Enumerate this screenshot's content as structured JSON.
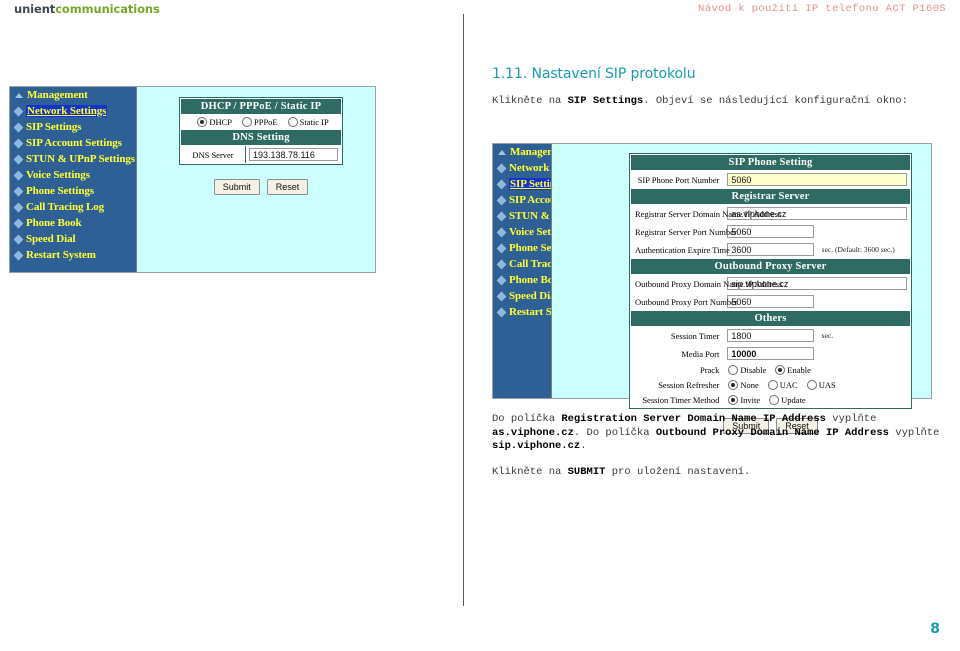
{
  "header": {
    "logo_part1": "unient",
    "logo_part2": "communications",
    "doc_title": "Návod k použití IP telefonu ACT P160S",
    "colors": {
      "logo_dark": "#3d4a52",
      "logo_green": "#7ba428",
      "title_red": "#e8908f"
    }
  },
  "document": {
    "section_title": "1.11. Nastavení SIP protokolu",
    "title_color": "#189ab4",
    "intro_before": "Klikněte na ",
    "intro_bold": "SIP Settings",
    "intro_after": ". Objeví se následující konfigurační okno:",
    "note_1": "Do políčka ",
    "note_1_bold": "Registration Server Domain Name IP Address",
    "note_2": " vyplňte ",
    "note_2_bold": "as.viphone.cz",
    "note_3": ". Do políčka ",
    "note_3_bold": "Outbound Proxy Domain Name IP Address",
    "note_4": " vyplňte ",
    "note_4_bold": "sip.viphone.cz",
    "note_5": ".",
    "final_before": "Klikněte na ",
    "final_bold": "SUBMIT",
    "final_after": " pro uložení nastavení.",
    "page_number": "8"
  },
  "menu": {
    "items": [
      {
        "label": "Management",
        "icon": "triangle-up-icon",
        "selected": false
      },
      {
        "label": "Network Settings",
        "icon": "diamond-icon",
        "selected": false
      },
      {
        "label": "SIP Settings",
        "icon": "diamond-icon",
        "selected": false
      },
      {
        "label": "SIP Account Settings",
        "icon": "diamond-icon",
        "selected": false
      },
      {
        "label": "STUN & UPnP Settings",
        "icon": "diamond-icon",
        "selected": false
      },
      {
        "label": "Voice Settings",
        "icon": "diamond-icon",
        "selected": false
      },
      {
        "label": "Phone Settings",
        "icon": "diamond-icon",
        "selected": false
      },
      {
        "label": "Call Tracing Log",
        "icon": "diamond-icon",
        "selected": false
      },
      {
        "label": "Phone Book",
        "icon": "diamond-icon",
        "selected": false
      },
      {
        "label": "Speed Dial",
        "icon": "diamond-icon",
        "selected": false
      },
      {
        "label": "Restart System",
        "icon": "diamond-icon",
        "selected": false
      }
    ],
    "selected_left": "Network Settings",
    "selected_right": "SIP Settings",
    "bg_color": "#2f6095",
    "text_color": "#ffff33",
    "highlight_color": "#1433c8"
  },
  "screenshot_network": {
    "section_dhcp_header": "DHCP / PPPoE / Static IP",
    "radios_mode": [
      {
        "label": "DHCP",
        "checked": true
      },
      {
        "label": "PPPoE",
        "checked": false
      },
      {
        "label": "Static IP",
        "checked": false
      }
    ],
    "section_dns_header": "DNS  Setting",
    "dns_server_label": "DNS Server",
    "dns_server_value": "193.138.78.116",
    "submit_label": "Submit",
    "reset_label": "Reset"
  },
  "screenshot_sip": {
    "hdr_phone": "SIP Phone Setting",
    "row_phone_port_label": "SIP Phone Port Number",
    "row_phone_port_value": "5060",
    "hdr_registrar": "Registrar Server",
    "row_reg_domain_label": "Registrar Server Domain Name IP Address",
    "row_reg_domain_value": "as.viphone.cz",
    "row_reg_port_label": "Registrar Server Port Number",
    "row_reg_port_value": "5060",
    "row_auth_label": "Authentication Expire Time",
    "row_auth_value": "3600",
    "row_auth_unit": "sec.   (Default: 3600 sec.)",
    "hdr_outbound": "Outbound Proxy Server",
    "row_out_domain_label": "Outbound Proxy Domain Name IP Address",
    "row_out_domain_value": "sip.viphone.cz",
    "row_out_port_label": "Outbound Proxy Port Number",
    "row_out_port_value": "5060",
    "hdr_others": "Others",
    "row_session_timer_label": "Session Timer",
    "row_session_timer_value": "1800",
    "row_session_timer_unit": "sec.",
    "row_media_port_label": "Media Port",
    "row_media_port_value": "10000",
    "row_prack_label": "Prack",
    "prack_options": [
      {
        "label": "Disable",
        "checked": false
      },
      {
        "label": "Enable",
        "checked": true
      }
    ],
    "row_refresher_label": "Session Refresher",
    "refresher_options": [
      {
        "label": "None",
        "checked": true
      },
      {
        "label": "UAC",
        "checked": false
      },
      {
        "label": "UAS",
        "checked": false
      }
    ],
    "row_method_label": "Session Timer Method",
    "method_options": [
      {
        "label": "Invite",
        "checked": true
      },
      {
        "label": "Update",
        "checked": false
      }
    ],
    "submit_label": "Submit",
    "reset_label": "Reset",
    "header_bg": "#2e6b62",
    "pane_bg": "#ccffff",
    "highlight_field_bg": "#ffffcc"
  }
}
